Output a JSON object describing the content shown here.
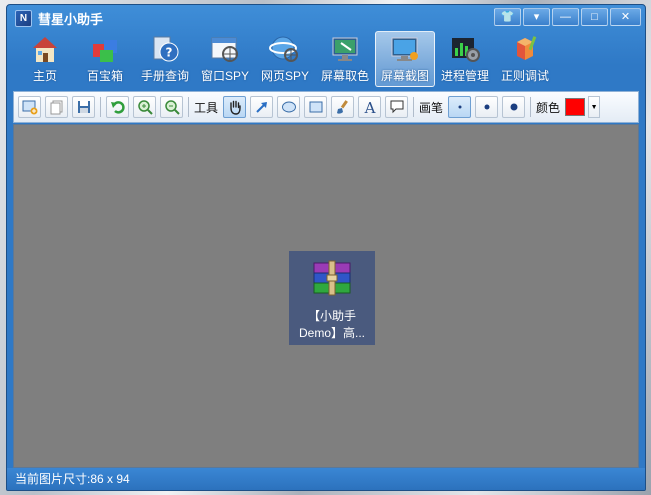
{
  "window": {
    "title": "彗星小助手",
    "controls": {
      "skin": "👕",
      "menu": "▾",
      "minimize": "—",
      "maximize": "□",
      "close": "✕"
    }
  },
  "nav": {
    "items": [
      {
        "label": "主页",
        "icon": "home-icon"
      },
      {
        "label": "百宝箱",
        "icon": "toolbox-icon"
      },
      {
        "label": "手册查询",
        "icon": "manual-help-icon"
      },
      {
        "label": "窗口SPY",
        "icon": "window-spy-icon"
      },
      {
        "label": "网页SPY",
        "icon": "web-spy-icon"
      },
      {
        "label": "屏幕取色",
        "icon": "color-picker-icon"
      },
      {
        "label": "屏幕截图",
        "icon": "screenshot-icon",
        "active": true
      },
      {
        "label": "进程管理",
        "icon": "process-manager-icon"
      },
      {
        "label": "正则调试",
        "icon": "regex-debug-icon"
      }
    ]
  },
  "toolbar": {
    "tools_label": "工具",
    "pen_label": "画笔",
    "color_label": "颜色",
    "selected_color": "#ff0000"
  },
  "capture": {
    "icon": "winrar-archive-icon",
    "line1": "【小助手",
    "line2": "Demo】高..."
  },
  "status": {
    "text": "当前图片尺寸:86 x 94"
  },
  "colors": {
    "title_blue": "#2f79c6",
    "canvas_gray": "#7f7f7f",
    "accent_red": "#ff0000"
  }
}
